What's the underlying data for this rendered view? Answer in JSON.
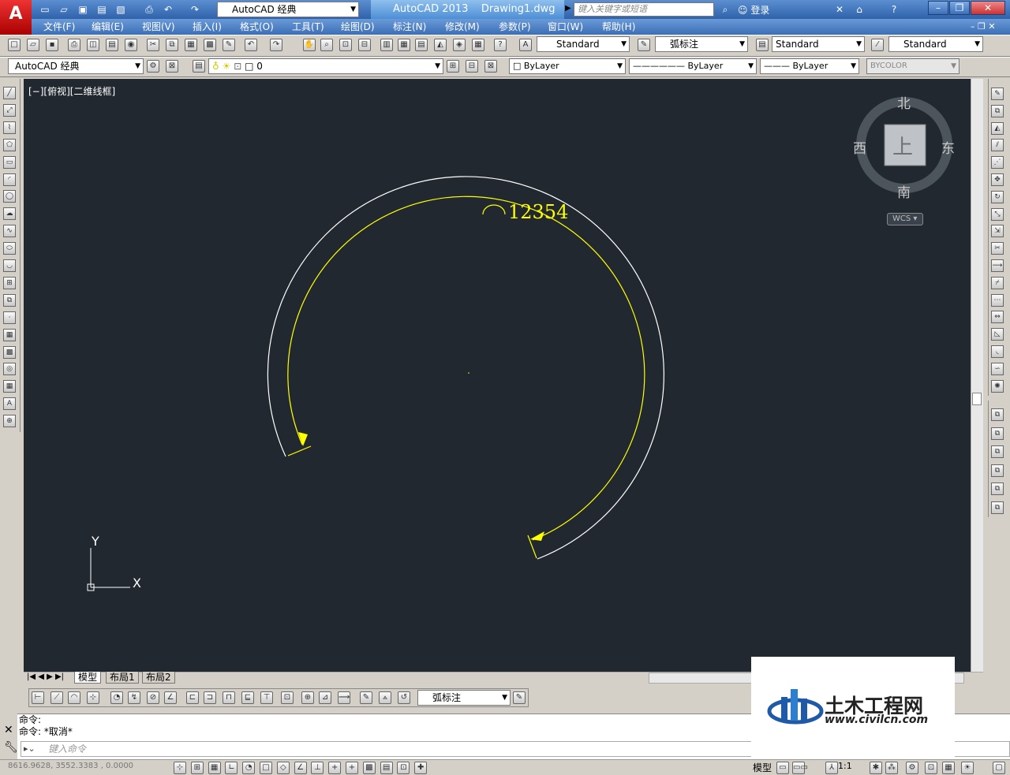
{
  "titlebar": {
    "workspace": "AutoCAD 经典",
    "app_name": "AutoCAD 2013",
    "file_name": "Drawing1.dwg",
    "search_placeholder": "键入关键字或短语",
    "login": "登录"
  },
  "menu": [
    "文件(F)",
    "编辑(E)",
    "视图(V)",
    "插入(I)",
    "格式(O)",
    "工具(T)",
    "绘图(D)",
    "标注(N)",
    "修改(M)",
    "参数(P)",
    "窗口(W)",
    "帮助(H)"
  ],
  "styles": {
    "text_style": "Standard",
    "dim_style": "弧标注",
    "table_style": "Standard",
    "mleader_style": "Standard"
  },
  "layers": {
    "workspace_combo": "AutoCAD 经典",
    "current_layer": "0",
    "color": "ByLayer",
    "linetype": "ByLayer",
    "lineweight": "ByLayer",
    "plotstyle": "BYCOLOR"
  },
  "viewport": {
    "label": "[−][俯视][二维线框]",
    "dimension_text": "12354"
  },
  "viewcube": {
    "north": "北",
    "south": "南",
    "east": "东",
    "west": "西",
    "top": "上",
    "wcs": "WCS"
  },
  "ucs": {
    "x": "X",
    "y": "Y"
  },
  "tabs": [
    "模型",
    "布局1",
    "布局2"
  ],
  "dim_toolbar": {
    "style": "弧标注"
  },
  "command": {
    "history": [
      "命令:",
      "命令: *取消*"
    ],
    "placeholder": "键入命令"
  },
  "status": {
    "coords": "8616.9628, 3552.3383 , 0.0000",
    "model": "模型",
    "scale": "1:1"
  },
  "watermark": {
    "name": "土木工程网",
    "url": "www.civilcn.com"
  },
  "colors": {
    "canvas": "#212830",
    "arc": "#ffffff",
    "dimension": "#ffff00"
  }
}
